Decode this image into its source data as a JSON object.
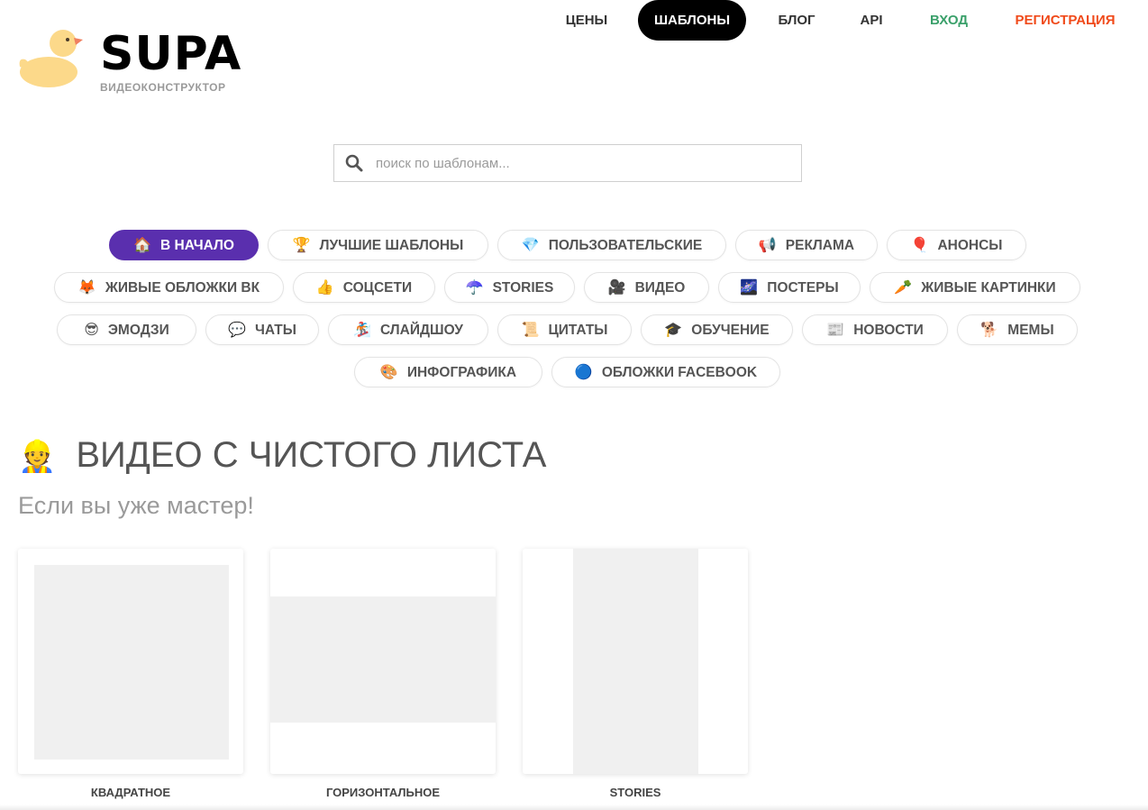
{
  "header": {
    "brand": "SUPA",
    "brand_subtitle": "ВИДЕОКОНСТРУКТОР",
    "nav": [
      {
        "label": "ЦЕНЫ"
      },
      {
        "label": "ШАБЛОНЫ"
      },
      {
        "label": "БЛОГ"
      },
      {
        "label": "API"
      },
      {
        "label": "ВХОД"
      },
      {
        "label": "РЕГИСТРАЦИЯ"
      }
    ]
  },
  "search": {
    "placeholder": "поиск по шаблонам..."
  },
  "categories": [
    {
      "emoji": "🏠",
      "label": "В НАЧАЛО"
    },
    {
      "emoji": "🏆",
      "label": "ЛУЧШИЕ ШАБЛОНЫ"
    },
    {
      "emoji": "💎",
      "label": "ПОЛЬЗОВАТЕЛЬСКИЕ"
    },
    {
      "emoji": "📢",
      "label": "РЕКЛАМА"
    },
    {
      "emoji": "🎈",
      "label": "АНОНСЫ"
    },
    {
      "emoji": "🦊",
      "label": "ЖИВЫЕ ОБЛОЖКИ ВК"
    },
    {
      "emoji": "👍",
      "label": "СОЦСЕТИ"
    },
    {
      "emoji": "☂️",
      "label": "STORIES"
    },
    {
      "emoji": "🎥",
      "label": "ВИДЕО"
    },
    {
      "emoji": "🌌",
      "label": "ПОСТЕРЫ"
    },
    {
      "emoji": "🥕",
      "label": "ЖИВЫЕ КАРТИНКИ"
    },
    {
      "emoji": "😎",
      "label": "ЭМОДЗИ"
    },
    {
      "emoji": "💬",
      "label": "ЧАТЫ"
    },
    {
      "emoji": "🏂",
      "label": "СЛАЙДШОУ"
    },
    {
      "emoji": "📜",
      "label": "ЦИТАТЫ"
    },
    {
      "emoji": "🎓",
      "label": "ОБУЧЕНИЕ"
    },
    {
      "emoji": "📰",
      "label": "НОВОСТИ"
    },
    {
      "emoji": "🐕",
      "label": "МЕМЫ"
    },
    {
      "emoji": "🎨",
      "label": "ИНФОГРАФИКА"
    },
    {
      "emoji": "🔵",
      "label": "ОБЛОЖКИ FACEBOOK"
    }
  ],
  "section": {
    "emoji": "👷",
    "title": "ВИДЕО С ЧИСТОГО ЛИСТА",
    "subtitle": "Если вы уже мастер!",
    "cards": [
      {
        "label": "КВАДРАТНОЕ"
      },
      {
        "label": "ГОРИЗОНТАЛЬНОЕ"
      },
      {
        "label": "STORIES"
      }
    ]
  },
  "colors": {
    "accent": "#5a2fae",
    "login": "#3aa06a",
    "register": "#f04a1a",
    "duck": "#fcd98a",
    "beak": "#f08060"
  },
  "icons": {
    "logo": "duck-icon",
    "search": "search-icon"
  }
}
